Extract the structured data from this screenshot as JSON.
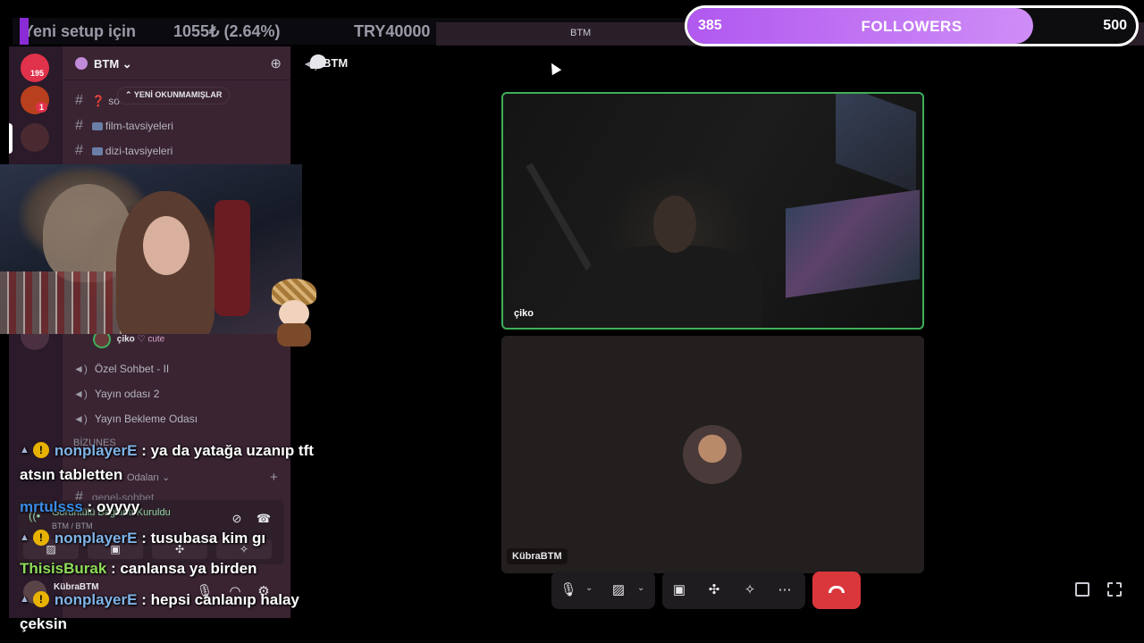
{
  "ticker": {
    "text1": "Yeni setup için",
    "text2": "1055₺ (2.64%)",
    "text3": "TRY40000"
  },
  "window": {
    "title": "BTM"
  },
  "followers": {
    "current": "385",
    "label": "FOLLOWERS",
    "goal": "500",
    "progress": 0.77
  },
  "rail": {
    "badge1": "195",
    "badge2": "1"
  },
  "server": {
    "name": "BTM"
  },
  "sidebar": {
    "unread_pill": "YENİ OKUNMAMIŞLAR",
    "channels": [
      {
        "emoji": "❓",
        "name": "so"
      },
      {
        "emoji": "",
        "name": "film-tavsiyeleri"
      },
      {
        "emoji": "",
        "name": "dizi-tavsiyeleri"
      }
    ],
    "member": {
      "name": "çiko",
      "tag": "cute"
    },
    "voice_channels": [
      "Özel Sohbet - II",
      "Yayın odası 2",
      "Yayın Bekleme Odası"
    ],
    "category_partial": "BİZUNES",
    "category": "Odaları",
    "partial_channel": "genel-sohbet"
  },
  "voice_panel": {
    "status": "Görüntülü Bağlantı Kuruldu",
    "sub": "BTM / BTM",
    "username": "KübraBTM"
  },
  "main": {
    "channel_name": "BTM",
    "tile1_name": "çiko",
    "tile2_name": "KübraBTM"
  },
  "chat": [
    {
      "user": "nonplayerE",
      "user_color": "#7fb4e8",
      "text": " : ya da yatağa uzanıp tft",
      "cont": "atsın tabletten",
      "icons": true
    },
    {
      "user": "mrtulsss",
      "user_color": "#3b8be8",
      "text": " : oyyyy",
      "icons": false
    },
    {
      "user": "nonplayerE",
      "user_color": "#7fb4e8",
      "text": " : tusubasa kim gı",
      "icons": true
    },
    {
      "user": "ThisisBurak",
      "user_color": "#8fdc5a",
      "text": " : canlansa ya birden",
      "icons": false
    },
    {
      "user": "nonplayerE",
      "user_color": "#7fb4e8",
      "text": " : hepsi canlanıp halay",
      "cont": "çeksin",
      "icons": true
    }
  ]
}
